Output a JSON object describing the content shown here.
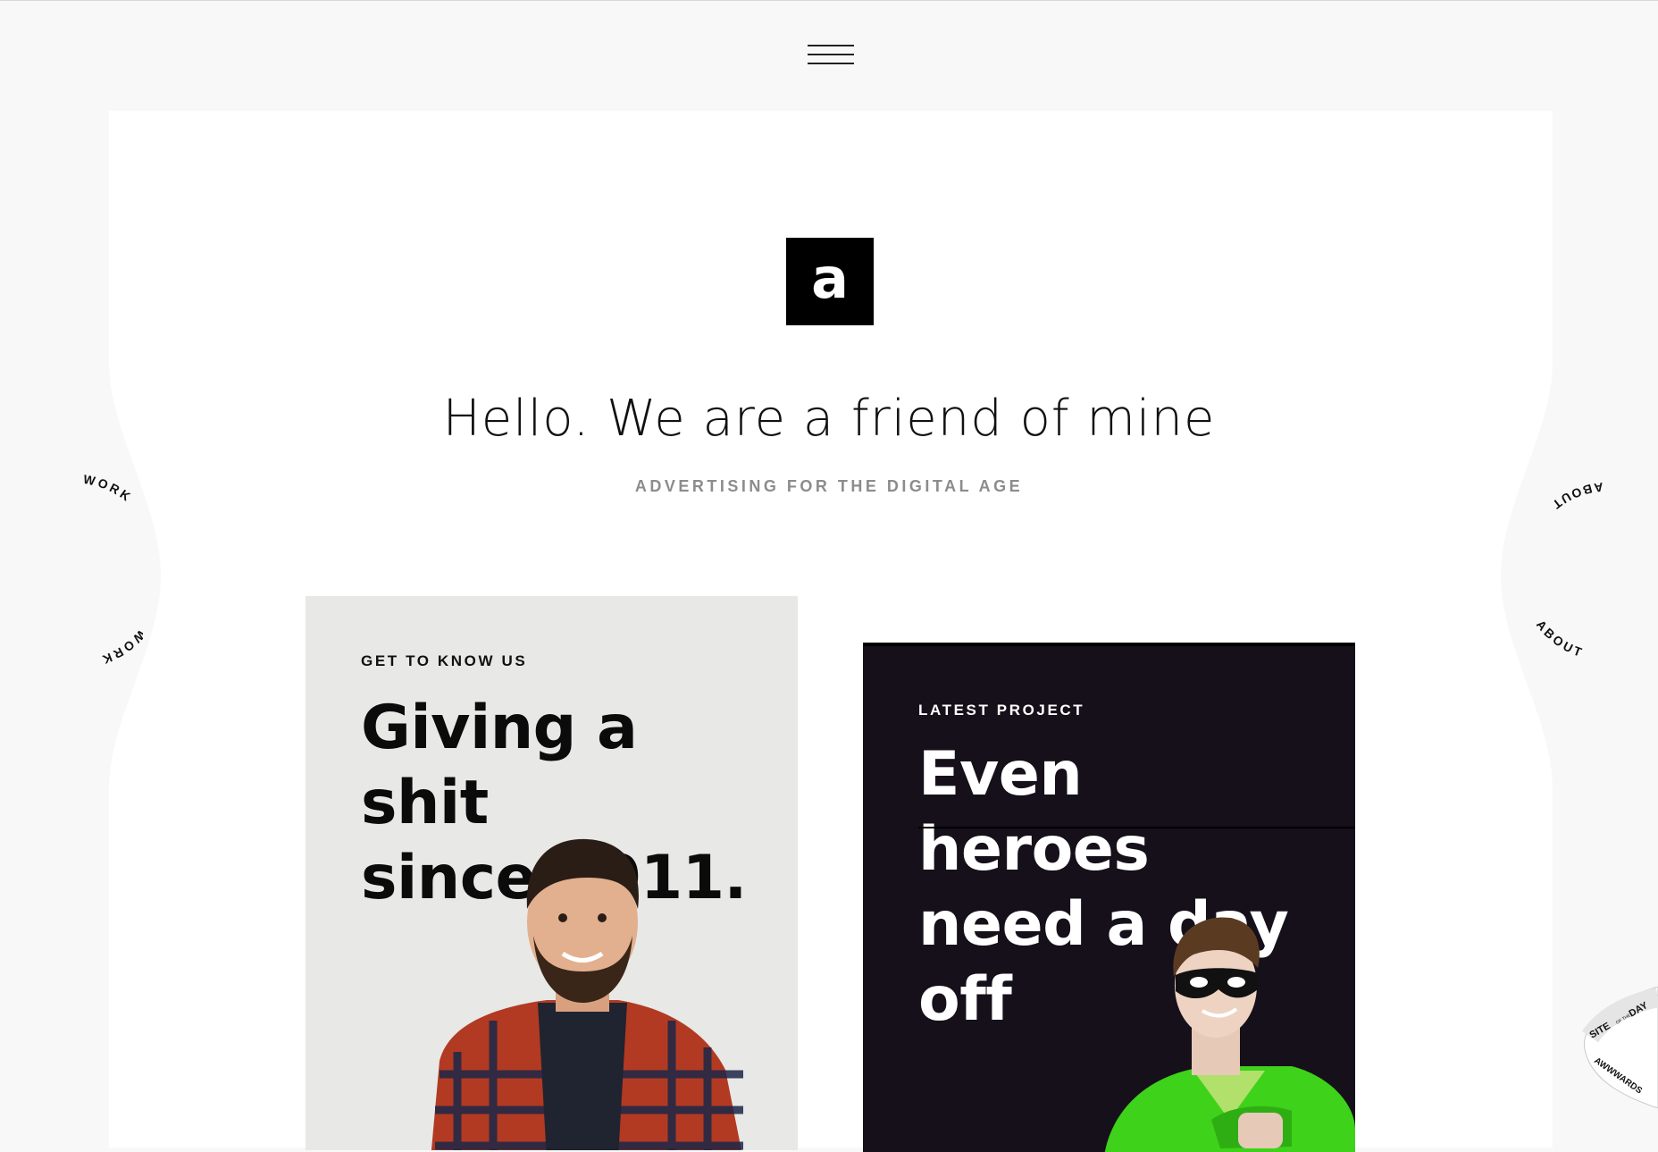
{
  "header": {
    "menu_icon": "hamburger-menu-icon"
  },
  "logo": {
    "letter": "a"
  },
  "hero": {
    "headline": "Hello. We are a friend of mine",
    "tagline": "ADVERTISING FOR THE DIGITAL AGE"
  },
  "cards": {
    "about": {
      "eyebrow": "GET TO KNOW US",
      "title_line1": "Giving a shit",
      "title_line2": "since 2011.",
      "image": "smiling-man-in-plaid-shirt"
    },
    "project": {
      "eyebrow": "LATEST PROJECT",
      "title_line1": "Even heroes",
      "title_line2": "need a day",
      "title_line3": "off",
      "image": "masked-hero-in-green-suit"
    }
  },
  "side_nav": {
    "left_label": "WORK",
    "right_label": "ABOUT"
  },
  "badge": {
    "line1": "SITE",
    "line2": "OF THE",
    "line3": "DAY",
    "brand": "AWWWARDS"
  },
  "colors": {
    "background": "#f8f8f8",
    "sheet": "#ffffff",
    "about_card": "#e8e8e6",
    "project_card": "#16101a",
    "hero_green": "#3ed21a"
  }
}
